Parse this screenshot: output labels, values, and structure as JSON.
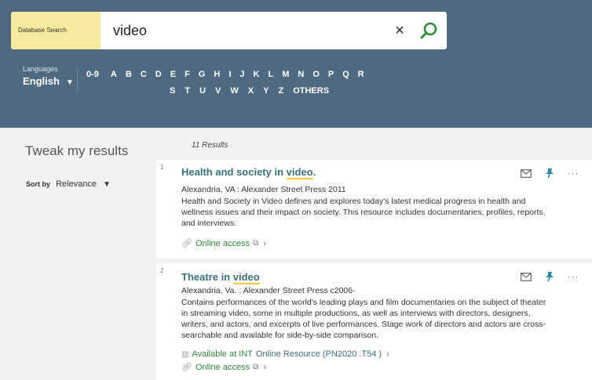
{
  "search": {
    "scope_label": "Database Search",
    "query": "video",
    "clear_label": "×"
  },
  "languages": {
    "label": "Languages",
    "selected": "English"
  },
  "alphabet": {
    "row1": [
      "0-9",
      "A",
      "B",
      "C",
      "D",
      "E",
      "F",
      "G",
      "H",
      "I",
      "J",
      "K",
      "L",
      "M",
      "N",
      "O",
      "P",
      "Q",
      "R"
    ],
    "row2": [
      "S",
      "T",
      "U",
      "V",
      "W",
      "X",
      "Y",
      "Z",
      "OTHERS"
    ]
  },
  "sidebar": {
    "title": "Tweak my results",
    "sort_by_label": "Sort by",
    "sort_value": "Relevance"
  },
  "results": {
    "count_text": "11 Results",
    "items": [
      {
        "number": "1",
        "title_before": "Health and society in ",
        "title_highlight": "video",
        "title_after": ".",
        "publisher": "Alexandria, VA : Alexander Street Press 2011",
        "description": "Health and Society in Video defines and explores today's latest medical progress in health and wellness issues and their impact on society. This resource includes documentaries, profiles, reports, and interviews.",
        "online_access": "Online access"
      },
      {
        "number": "2",
        "title_before": "Theatre in ",
        "title_highlight": "video",
        "title_after": "",
        "publisher": "Alexandria, Va. : Alexander Street Press c2006-",
        "description": "Contains performances of the world's leading plays and film documentaries on the subject of theater in streaming video, some in multiple productions, as well as interviews with directors, designers, writers, and actors, and excerpts of live performances. Stage work of directors and actors are cross-searchable and available for side-by-side comparison.",
        "availability": "Available at INT",
        "location": "Online Resource (PN2020 .T54 )",
        "online_access": "Online access"
      }
    ]
  },
  "colors": {
    "header_bg": "#4f6a80",
    "scope_bg": "#f6eb9c",
    "title_color": "#3a6f7d",
    "access_green": "#2f8a3a",
    "highlight_underline": "#f2c641"
  }
}
